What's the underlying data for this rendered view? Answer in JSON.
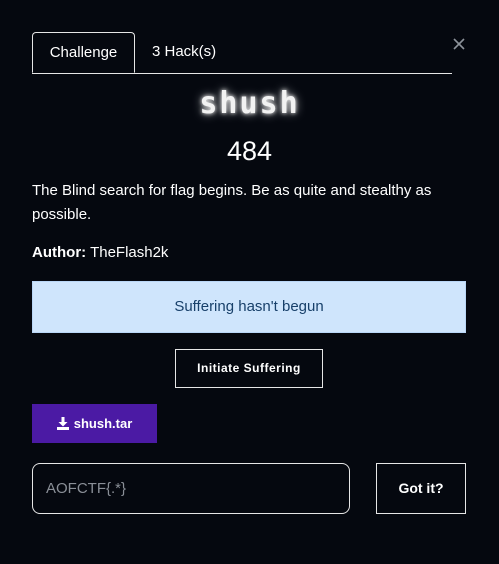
{
  "tabs": [
    {
      "label": "Challenge",
      "active": true
    },
    {
      "label": "3 Hack(s)",
      "active": false
    }
  ],
  "close_icon": "close-icon",
  "challenge": {
    "name": "shush",
    "points": "484",
    "description": "The Blind search for flag begins. Be as quite and stealthy as possible.",
    "author_label": "Author:",
    "author": "TheFlash2k"
  },
  "status": {
    "message": "Suffering hasn't begun",
    "background": "#cfe5fc",
    "text_color": "#18406a"
  },
  "instance": {
    "button_label": "Initiate Suffering"
  },
  "file": {
    "icon": "download-icon",
    "label": "shush.tar",
    "color": "#4b1aa4"
  },
  "submission": {
    "value": "",
    "placeholder": "AOFCTF{.*}",
    "button_label": "Got it?"
  }
}
